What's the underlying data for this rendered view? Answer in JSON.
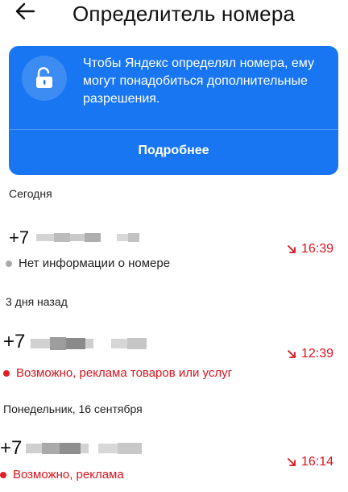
{
  "header": {
    "title": "Определитель номера"
  },
  "banner": {
    "text": "Чтобы Яндекс определял номера, ему\nмогут понадобиться дополнительные\nразрешения.",
    "button_label": "Подробнее",
    "color": "#1976F2"
  },
  "sections": [
    {
      "header": "Сегодня",
      "calls": [
        {
          "number_prefix": "+7",
          "time": "16:39",
          "status": "Нет информации о номере",
          "status_color": "#222222",
          "dot_color": "#aaaaaa"
        }
      ]
    },
    {
      "header": "3 дня назад",
      "calls": [
        {
          "number_prefix": "+7",
          "time": "12:39",
          "status": "Возможно, реклама товаров или услуг",
          "status_color": "#d9131e",
          "dot_color": "#e01e26"
        }
      ]
    },
    {
      "header": "Понедельник, 16 сентября",
      "calls": [
        {
          "number_prefix": "+7",
          "time": "16:14",
          "status": "Возможно, реклама",
          "status_color": "#d9131e",
          "dot_color": "#e01e26"
        }
      ]
    }
  ],
  "colors": {
    "missed_call": "#d9131e"
  }
}
